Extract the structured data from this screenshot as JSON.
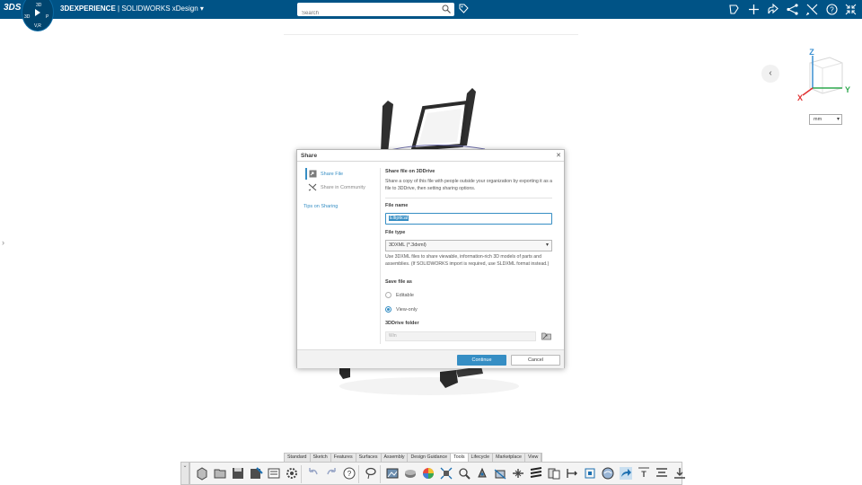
{
  "app": {
    "logo": "3DS",
    "brand_bold": "3DEXPERIENCE",
    "brand_rest": " | SOLIDWORKS  xDesign ",
    "compass_labels": {
      "top": "3D",
      "left": "3D",
      "right": "P",
      "bottom": "V,R"
    },
    "search_placeholder": "Search"
  },
  "topbar_icons": [
    "add-note-icon",
    "plus-icon",
    "share-arrow-icon",
    "network-share-icon",
    "tools-icon",
    "help-icon",
    "collapse-icon"
  ],
  "viewport": {
    "unit_value": "mm",
    "triad": {
      "x": "X",
      "y": "Y",
      "z": "Z"
    },
    "colors": {
      "x": "#e03131",
      "y": "#2fa84f",
      "z": "#3a8fd1"
    }
  },
  "dialog": {
    "title": "Share",
    "nav": {
      "share_file": "Share File",
      "share_community": "Share in Community",
      "tips": "Tips on Sharing"
    },
    "heading": "Share file on 3DDrive",
    "description": "Share a copy of this file with people outside your organization by exporting it as a file to 3DDrive, then setting sharing options.",
    "file_name_label": "File name",
    "file_name_value": "Elliptical",
    "file_type_label": "File type",
    "file_type_value": "3DXML (*.3dxml)",
    "file_type_help": "Use 3DXML files to share viewable, information-rich 3D models of parts and assemblies. (If SOLIDWORKS import is required, use SLDXML format instead.)",
    "save_as_label": "Save file as",
    "option_editable": "Editable",
    "option_viewonly": "View-only",
    "selected_option": "View-only",
    "folder_label": "3DDrive folder",
    "folder_value": "Win",
    "continue_label": "Continue",
    "cancel_label": "Cancel",
    "accent": "#368ec4"
  },
  "toolbar": {
    "tabs": [
      "Standard",
      "Sketch",
      "Features",
      "Surfaces",
      "Assembly",
      "Design Guidance",
      "Tools",
      "Lifecycle",
      "Marketplace",
      "View"
    ],
    "active_tab": "Tools",
    "icons": [
      "new-part-icon",
      "open-icon",
      "save-icon",
      "save-as-icon",
      "properties-icon",
      "settings-icon",
      "undo-icon",
      "redo-icon",
      "help-icon",
      "lasso-icon",
      "image-icon",
      "appearance-icon",
      "color-wheel-icon",
      "explode-icon",
      "measure-icon",
      "mass-properties-icon",
      "section-icon",
      "interference-icon",
      "zebra-icon",
      "compare-icon",
      "check-icon",
      "reference-icon",
      "render-icon",
      "share-icon",
      "3d-text-icon",
      "align-icon",
      "export-icon"
    ]
  }
}
